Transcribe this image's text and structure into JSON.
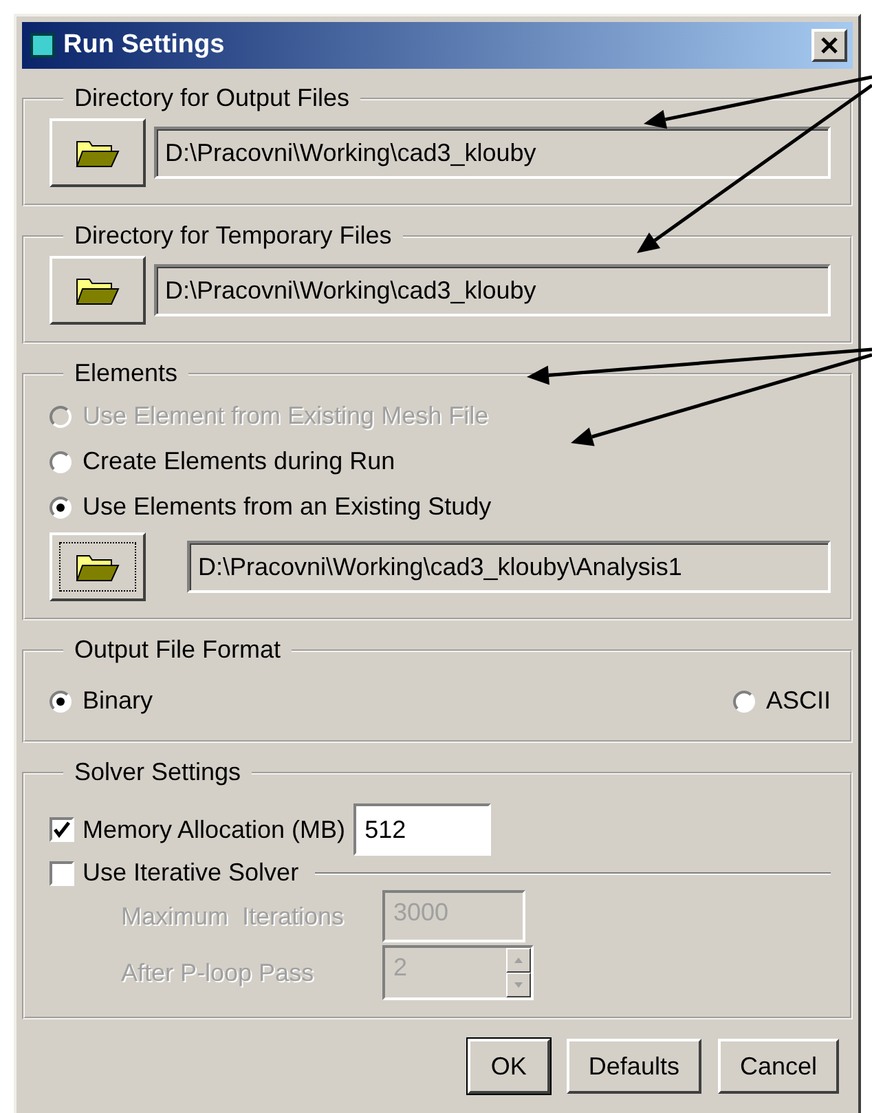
{
  "window": {
    "title": "Run Settings"
  },
  "output_directory": {
    "label": "Directory for Output Files",
    "value": "D:\\Pracovni\\Working\\cad3_klouby"
  },
  "temporary_directory": {
    "label": "Directory for Temporary Files",
    "value": "D:\\Pracovni\\Working\\cad3_klouby"
  },
  "elements": {
    "label": "Elements",
    "options": [
      {
        "label": "Use Element from Existing Mesh File",
        "selected": false,
        "disabled": true
      },
      {
        "label": "Create Elements during Run",
        "selected": false,
        "disabled": false
      },
      {
        "label": "Use Elements from an Existing Study",
        "selected": true,
        "disabled": false
      }
    ],
    "browse_focused": true,
    "study_path": "D:\\Pracovni\\Working\\cad3_klouby\\Analysis1"
  },
  "output_format": {
    "label": "Output File Format",
    "options": [
      {
        "label": "Binary",
        "selected": true
      },
      {
        "label": "ASCII",
        "selected": false
      }
    ]
  },
  "solver": {
    "label": "Solver Settings",
    "memory": {
      "label": "Memory Allocation (MB)",
      "checked": true,
      "value": "512"
    },
    "iterative": {
      "label": "Use Iterative Solver",
      "checked": false
    },
    "max_iterations": {
      "label": "Maximum  Iterations",
      "value": "3000",
      "disabled": true
    },
    "after_pass": {
      "label": "After P-loop Pass",
      "value": "2",
      "disabled": true
    }
  },
  "buttons": [
    {
      "label": "OK",
      "default": true
    },
    {
      "label": "Defaults",
      "default": false
    },
    {
      "label": "Cancel",
      "default": false
    }
  ]
}
